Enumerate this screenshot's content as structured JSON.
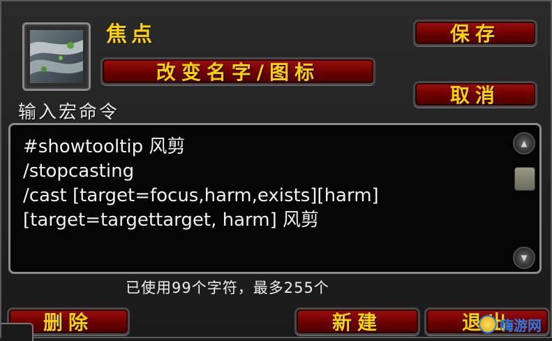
{
  "macro": {
    "name": "焦点",
    "icon": "ghostly-strike-icon"
  },
  "buttons": {
    "rename": "改变名字/图标",
    "save": "保存",
    "cancel": "取消",
    "delete": "删除",
    "new": "新建",
    "exit": "退出"
  },
  "editor": {
    "label": "输入宏命令",
    "lines": [
      "#showtooltip 风剪",
      "/stopcasting",
      "/cast [target=focus,harm,exists][harm]",
      "[target=targettarget, harm] 风剪"
    ],
    "char_count": "已使用99个字符，最多255个"
  },
  "watermark": {
    "text": "嗨游网",
    "logo": "smiley-logo"
  }
}
